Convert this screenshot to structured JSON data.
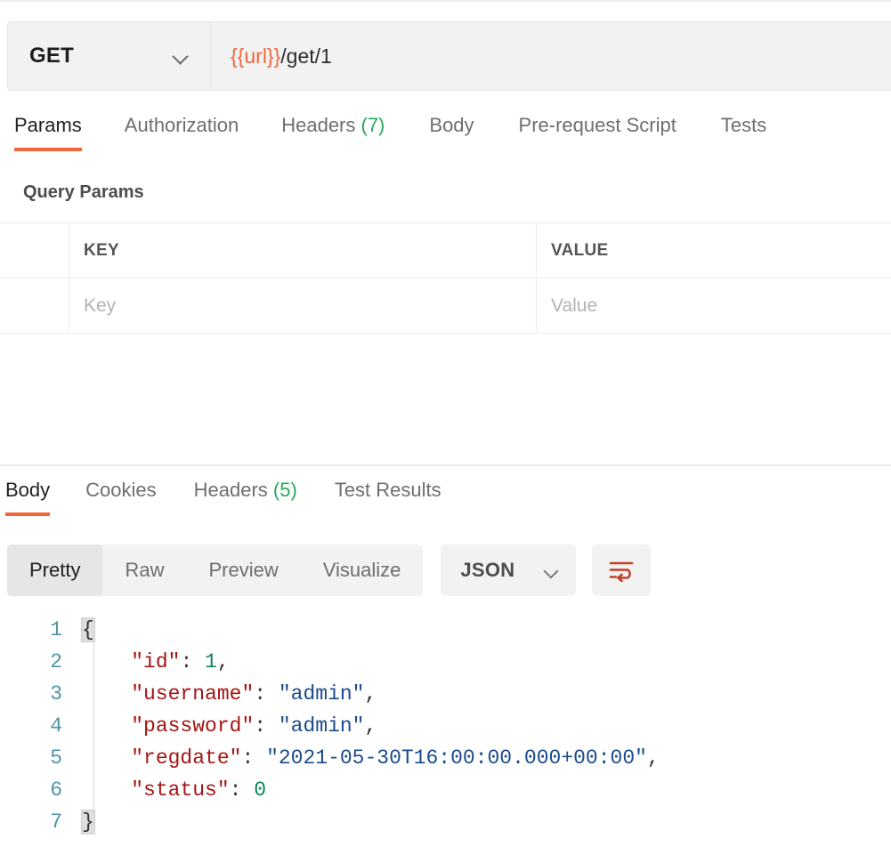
{
  "request": {
    "method": "GET",
    "url_variable": "{{url}}",
    "url_path": "/get/1",
    "method_chevron_icon": "chevron-down-icon",
    "tabs": [
      {
        "label": "Params",
        "count": "",
        "active": true
      },
      {
        "label": "Authorization",
        "count": "",
        "active": false
      },
      {
        "label": "Headers",
        "count": "(7)",
        "active": false
      },
      {
        "label": "Body",
        "count": "",
        "active": false
      },
      {
        "label": "Pre-request Script",
        "count": "",
        "active": false
      },
      {
        "label": "Tests",
        "count": "",
        "active": false
      }
    ],
    "query_params": {
      "section_title": "Query Params",
      "columns": [
        "",
        "KEY",
        "VALUE"
      ],
      "rows": [
        {
          "key_placeholder": "Key",
          "value_placeholder": "Value"
        }
      ]
    }
  },
  "response": {
    "tabs": [
      {
        "label": "Body",
        "count": "",
        "active": true
      },
      {
        "label": "Cookies",
        "count": "",
        "active": false
      },
      {
        "label": "Headers",
        "count": "(5)",
        "active": false
      },
      {
        "label": "Test Results",
        "count": "",
        "active": false
      }
    ],
    "format_segments": [
      {
        "label": "Pretty",
        "active": true
      },
      {
        "label": "Raw",
        "active": false
      },
      {
        "label": "Preview",
        "active": false
      },
      {
        "label": "Visualize",
        "active": false
      }
    ],
    "format_select": {
      "value": "JSON",
      "chevron_icon": "chevron-down-icon"
    },
    "wrap_button_icon": "word-wrap-icon",
    "code": {
      "line_numbers": [
        "1",
        "2",
        "3",
        "4",
        "5",
        "6",
        "7"
      ],
      "lines": [
        {
          "brace": "{"
        },
        {
          "key": "\"id\"",
          "sep": ": ",
          "num": "1",
          "tail": ","
        },
        {
          "key": "\"username\"",
          "sep": ": ",
          "str": "\"admin\"",
          "tail": ","
        },
        {
          "key": "\"password\"",
          "sep": ": ",
          "str": "\"admin\"",
          "tail": ","
        },
        {
          "key": "\"regdate\"",
          "sep": ": ",
          "str": "\"2021-05-30T16:00:00.000+00:00\"",
          "tail": ","
        },
        {
          "key": "\"status\"",
          "sep": ": ",
          "num": "0",
          "tail": ""
        },
        {
          "brace": "}"
        }
      ]
    }
  },
  "colors": {
    "accent": "#f1663b",
    "count_green": "#26a85b",
    "json_key": "#a31515",
    "json_string": "#1a4b8c",
    "json_number": "#098658",
    "gutter": "#4f94a6"
  }
}
